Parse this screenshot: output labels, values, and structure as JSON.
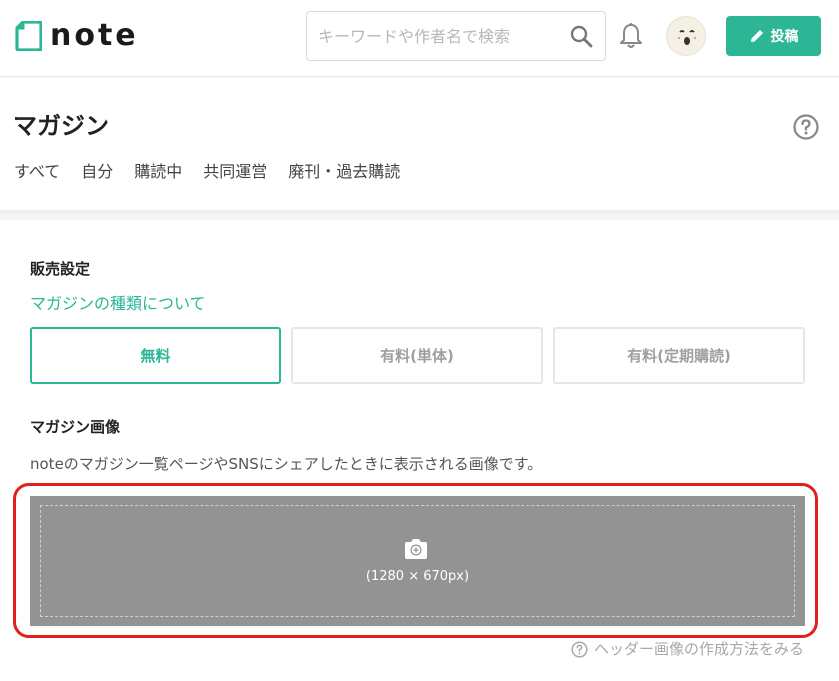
{
  "header": {
    "logo_text": "note",
    "search": {
      "placeholder": "キーワードや作者名で検索",
      "value": ""
    },
    "post_button_label": "投稿",
    "colors": {
      "brand": "#2cb696"
    }
  },
  "magazine": {
    "title": "マガジン",
    "tabs": [
      {
        "label": "すべて"
      },
      {
        "label": "自分"
      },
      {
        "label": "購読中"
      },
      {
        "label": "共同運営"
      },
      {
        "label": "廃刊・過去購読"
      }
    ]
  },
  "sales": {
    "label": "販売設定",
    "link_text": "マガジンの種類について",
    "options": [
      {
        "label": "無料",
        "selected": true
      },
      {
        "label": "有料(単体)",
        "selected": false
      },
      {
        "label": "有料(定期購読)",
        "selected": false
      }
    ]
  },
  "image": {
    "label": "マガジン画像",
    "description": "noteのマガジン一覧ページやSNSにシェアしたときに表示される画像です。",
    "size_hint": "(1280 × 670px)",
    "howto_link": "ヘッダー画像の作成方法をみる"
  },
  "icons": {
    "search": "search-icon",
    "notification": "bell-icon",
    "post": "pencil-icon",
    "help": "help-icon",
    "upload": "camera-plus-icon",
    "howto": "question-circle-icon"
  }
}
